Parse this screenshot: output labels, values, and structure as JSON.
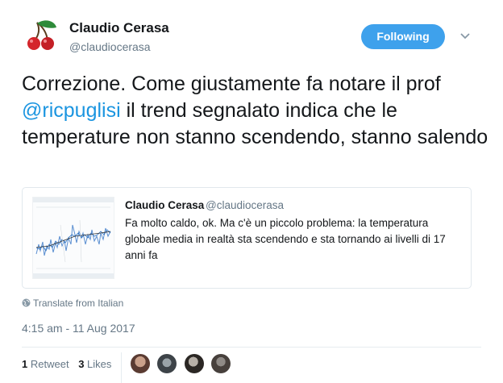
{
  "header": {
    "name": "Claudio Cerasa",
    "handle": "@claudiocerasa",
    "follow_label": "Following",
    "avatar_icon": "cherry-icon"
  },
  "tweet": {
    "text_before": "Correzione. Come giustamente fa notare il prof ",
    "mention": "@ricpuglisi",
    "text_after": " il trend segnalato indica che le temperature non stanno scendendo, stanno salendo"
  },
  "quoted": {
    "name": "Claudio Cerasa",
    "handle": "@claudiocerasa",
    "text": "Fa molto caldo, ok. Ma c'è un piccolo problema: la temperatura globale media in realtà sta scendendo e sta tornando ai livelli di 17 anni fa",
    "thumbnail_icon": "temperature-chart-thumbnail"
  },
  "translate_label": "Translate from Italian",
  "timestamp": "4:15 am - 11 Aug 2017",
  "stats": {
    "retweets_count": "1",
    "retweets_label": "Retweet",
    "likes_count": "3",
    "likes_label": "Likes"
  },
  "colors": {
    "accent": "#1b95e0",
    "follow_button": "#3ea1ec",
    "secondary_text": "#657786"
  }
}
